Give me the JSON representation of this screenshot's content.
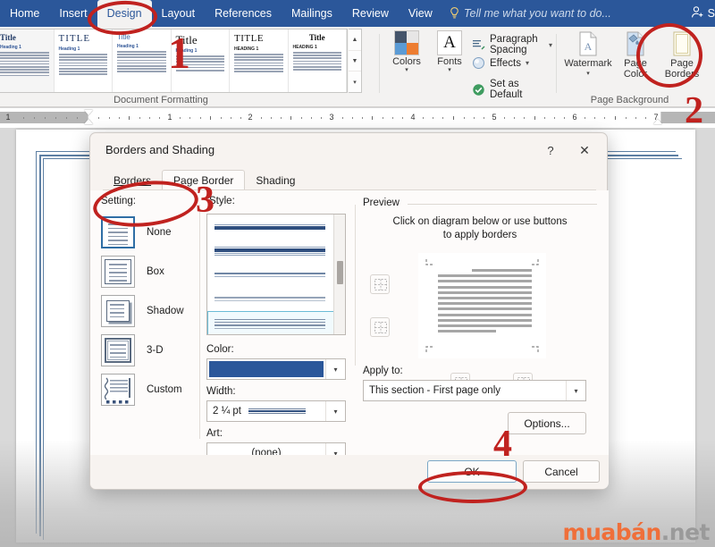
{
  "app": {
    "ribbon_tabs": [
      {
        "label": "Home",
        "active": false
      },
      {
        "label": "Insert",
        "active": false
      },
      {
        "label": "Design",
        "active": true
      },
      {
        "label": "Layout",
        "active": false
      },
      {
        "label": "References",
        "active": false
      },
      {
        "label": "Mailings",
        "active": false
      },
      {
        "label": "Review",
        "active": false
      },
      {
        "label": "View",
        "active": false
      }
    ],
    "tell_me": "Tell me what you want to do...",
    "share_label": "S",
    "accent_color": "#2b579a"
  },
  "ribbon": {
    "groups": [
      {
        "name": "document-formatting",
        "label": "Document Formatting"
      },
      {
        "name": "page-background",
        "label": "Page Background"
      }
    ],
    "gallery_items": [
      {
        "title": "Title",
        "heading": "Heading 1"
      },
      {
        "title": "TITLE",
        "heading": "Heading 1"
      },
      {
        "title": "Title",
        "heading": "Heading 1"
      },
      {
        "title": "Title",
        "heading": "Heading 1"
      },
      {
        "title": "TITLE",
        "heading": "HEADING 1"
      },
      {
        "title": "Title",
        "heading": "HEADING 1"
      }
    ],
    "themes": {
      "colors_label": "Colors",
      "fonts_label": "Fonts",
      "fonts_glyph": "A",
      "paragraph_spacing_label": "Paragraph Spacing",
      "effects_label": "Effects",
      "set_as_default_label": "Set as Default"
    },
    "page_background": {
      "watermark_label": "Watermark",
      "page_color_label_line1": "Page",
      "page_color_label_line2": "Color",
      "page_borders_label_line1": "Page",
      "page_borders_label_line2": "Borders"
    }
  },
  "ruler": {
    "numbers": [
      "1",
      "1",
      "2",
      "3",
      "4",
      "5",
      "6",
      "7"
    ]
  },
  "dialog": {
    "title": "Borders and Shading",
    "help_glyph": "?",
    "close_glyph": "✕",
    "tabs": [
      {
        "label": "Borders",
        "active": false
      },
      {
        "label": "Page Border",
        "active": true
      },
      {
        "label": "Shading",
        "active": false
      }
    ],
    "setting": {
      "label": "Setting:",
      "options": [
        {
          "label": "None",
          "selected": true
        },
        {
          "label": "Box",
          "selected": false
        },
        {
          "label": "Shadow",
          "selected": false
        },
        {
          "label": "3-D",
          "selected": false
        },
        {
          "label": "Custom",
          "selected": false
        }
      ]
    },
    "style": {
      "label": "Style:",
      "selected_index": 4,
      "options": [
        "thick-solid-single",
        "thick-double",
        "thin-double",
        "thin-double-gray",
        "triple-line"
      ]
    },
    "color": {
      "label": "Color:",
      "value_hex": "#2b579a"
    },
    "width": {
      "label": "Width:",
      "value": "2 ¼ pt"
    },
    "art": {
      "label": "Art:",
      "value": "(none)"
    },
    "preview": {
      "legend": "Preview",
      "hint_line1": "Click on diagram below or use buttons",
      "hint_line2": "to apply borders"
    },
    "apply_to": {
      "label": "Apply to:",
      "value": "This section - First page only"
    },
    "options_button": "Options...",
    "ok_button": "OK",
    "cancel_button": "Cancel"
  },
  "annotations": {
    "steps": [
      "1",
      "2",
      "3",
      "4"
    ]
  },
  "watermark": {
    "brand": "muabán",
    "suffix": ".net",
    "brand_color": "#ef6f3a"
  }
}
